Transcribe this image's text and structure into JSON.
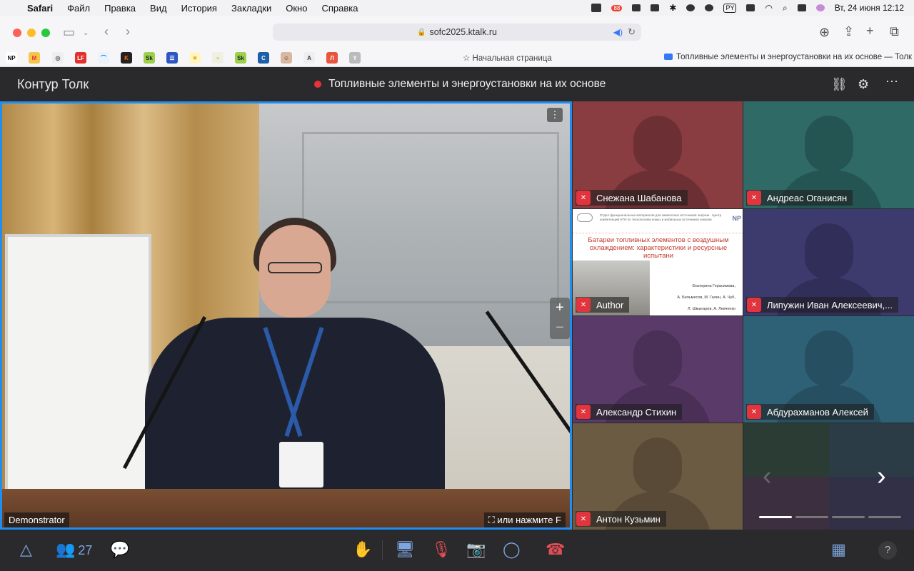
{
  "menubar": {
    "app": "Safari",
    "items": [
      "Файл",
      "Правка",
      "Вид",
      "История",
      "Закладки",
      "Окно",
      "Справка"
    ],
    "badge": "88",
    "lang": "PY",
    "datetime": "Вт, 24 июня  12:12"
  },
  "browser": {
    "url": "sofc2025.ktalk.ru",
    "home_link": "Начальная страница",
    "tab_title": "Топливные элементы и энергоустановки на их основе — Толк",
    "bookmarks": [
      "NP",
      "M",
      "◎",
      "LF",
      "⌒",
      "K",
      "Sk",
      "☰",
      "☀",
      "♆",
      "Sk",
      "C",
      "☺",
      "A",
      "Л",
      "Y"
    ]
  },
  "talk": {
    "brand": "Контур Толк",
    "meeting_title": "Топливные элементы и энергоустановки на их основе"
  },
  "main_video": {
    "label": "Demonstrator",
    "hint": "или нажмите F"
  },
  "participants": [
    {
      "name": "Снежана Шабанова",
      "color": "#8a3d41"
    },
    {
      "name": "Андреас Оганисян",
      "color": "#2f6a67"
    },
    {
      "name": "Author",
      "color": "#ffffff"
    },
    {
      "name": "Липужин Иван Алексеевич,...",
      "color": "#3d3a6e"
    },
    {
      "name": "Александр Стихин",
      "color": "#5a3a69"
    },
    {
      "name": "Абдурахманов Алексей",
      "color": "#2f6176"
    },
    {
      "name": "Антон Кузьмин",
      "color": "#6b5b43"
    }
  ],
  "slide": {
    "header": "Отдел функциональных материалов для химических источников энергии · Центр компетенций НТИ по технологиям новых и мобильных источников энергии",
    "title": "Батареи топливных элементов с воздушным охлаждением: характеристики и ресурсные испытани",
    "author_main": "Екатерина Герасимова,",
    "author_line2": "А. Бельмесов, М. Галин, А. Чуб,",
    "author_line3": "Л. Шмыгарев, А. Левченко",
    "logo": "NP"
  },
  "controls": {
    "participants_count": "27",
    "help": "?"
  },
  "colors": {
    "accent_border": "#1f8ef1",
    "mute_red": "#e1343c",
    "record_red": "#e8313b",
    "icon_blue": "#7ea6e0"
  }
}
